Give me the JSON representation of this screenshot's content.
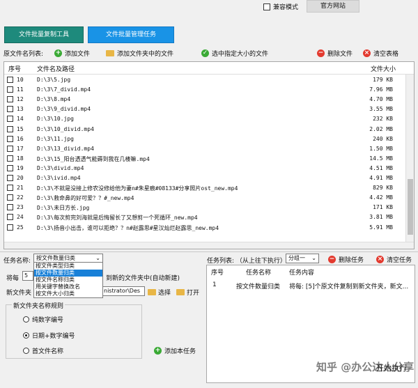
{
  "topbar": {
    "compat_label": "兼容模式",
    "official_label": "官方网站"
  },
  "main_tabs": [
    "文件批量复制工具",
    "文件批量管理任务"
  ],
  "source": {
    "label": "原文件名列表:",
    "add_file": "添加文件",
    "add_folder_files": "添加文件夹中的文件",
    "select_by_size": "选中指定大小的文件",
    "delete_file": "删除文件",
    "clear_table": "清空表格"
  },
  "file_table": {
    "headers": {
      "no": "序号",
      "path": "文件名及路径",
      "size": "文件大小"
    },
    "rows": [
      {
        "no": "10",
        "path": "D:\\3\\5.jpg",
        "size": "179 KB"
      },
      {
        "no": "11",
        "path": "D:\\3\\7_divid.mp4",
        "size": "7.96 MB"
      },
      {
        "no": "12",
        "path": "D:\\3\\8.mp4",
        "size": "4.70 MB"
      },
      {
        "no": "13",
        "path": "D:\\3\\9_divid.mp4",
        "size": "3.55 MB"
      },
      {
        "no": "14",
        "path": "D:\\3\\10.jpg",
        "size": "232 KB"
      },
      {
        "no": "15",
        "path": "D:\\3\\10_divid.mp4",
        "size": "2.02 MB"
      },
      {
        "no": "16",
        "path": "D:\\3\\11.jpg",
        "size": "240 KB"
      },
      {
        "no": "17",
        "path": "D:\\3\\13_divid.mp4",
        "size": "1.50 MB"
      },
      {
        "no": "18",
        "path": "D:\\3\\15_阳台透透气能薅到我在几楼嘛.mp4",
        "size": "14.5 MB"
      },
      {
        "no": "19",
        "path": "D:\\3\\divid.mp4",
        "size": "4.51 MB"
      },
      {
        "no": "20",
        "path": "D:\\3\\ivid.mp4",
        "size": "4.91 MB"
      },
      {
        "no": "21",
        "path": "D:\\3\\不就是没接上修农没修给他为妻n#朱星痕#08133#分享照片ost_new.mp4",
        "size": "829 KB"
      },
      {
        "no": "22",
        "path": "D:\\3\\救命鼻的好可爱？？#_new.mp4",
        "size": "4.42 MB"
      },
      {
        "no": "23",
        "path": "D:\\3\\未日方长.jpg",
        "size": "171 KB"
      },
      {
        "no": "24",
        "path": "D:\\3\\每次剪完刘海就是后悔留长了又想剪一个死循环_new.mp4",
        "size": "3.81 MB"
      },
      {
        "no": "25",
        "path": "D:\\3\\扬音小出击，谁可以拒绝？？n#赵露思#星汉灿烂赵露思_new.mp4",
        "size": "5.91 MB"
      }
    ]
  },
  "task": {
    "name_label": "任务名称:",
    "name_value": "按文件数量归类",
    "dropdown_options": [
      "按文件类型归类",
      "按文件数量归类",
      "按文件名称归类",
      "用关键字替换改名",
      "按文件大小归类"
    ],
    "selected_index": 1,
    "every_prefix": "将每",
    "every_value": "5",
    "every_suffix": "到新的文件夹中(自动新建)",
    "new_folder_label": "新文件夹",
    "path_value": "nistrator\\Des",
    "select_button": "选择",
    "open_button": "打开",
    "rule_legend": "新文件夹名称规则",
    "rules": [
      "纯数字编号",
      "日期+数字编号",
      "首文件名称"
    ],
    "selected_rule": 1,
    "add_task_button": "添加本任务"
  },
  "task_list": {
    "label": "任务列表: （从上往下执行）",
    "group_value": "分组一",
    "delete_task": "删除任务",
    "clear_task": "清空任务",
    "headers": {
      "no": "序号",
      "name": "任务名称",
      "content": "任务内容"
    },
    "rows": [
      {
        "no": "1",
        "name": "按文件数量归类",
        "content": "将每: [5]个原文件复制到新文件夹，新文..."
      }
    ]
  },
  "watermark": "知乎 @办公达人分享",
  "start_button": "开始执行",
  "colors": {
    "tab_green": "#1e8a7c",
    "tab_blue": "#1993e6",
    "selection_blue": "#1880d8"
  }
}
